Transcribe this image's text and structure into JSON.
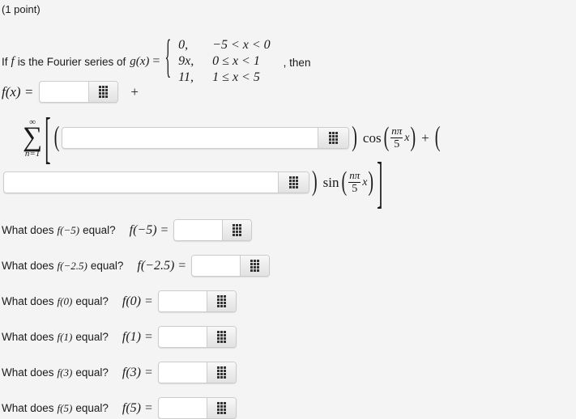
{
  "header": {
    "point_label": "(1 point)"
  },
  "problem": {
    "intro_prefix": "If",
    "intro_f": "f",
    "intro_middle": "is the Fourier series of",
    "intro_g": "g(x)",
    "equals": "=",
    "then_text": ", then",
    "cases": [
      {
        "value": "0,",
        "condition": "−5 < x < 0"
      },
      {
        "value": "9x,",
        "condition": "0 ≤ x < 1"
      },
      {
        "value": "11,",
        "condition": "1 ≤ x < 5"
      }
    ]
  },
  "series": {
    "fx_label": "f(x) =",
    "plus_label": "+",
    "sigma_top": "∞",
    "sigma_symbol": "∑",
    "sigma_bottom": "n=1",
    "bracket_open": "[",
    "bracket_close": "]",
    "paren_open": "(",
    "paren_close": ")",
    "cos_label": "cos",
    "sin_label": "sin",
    "frac_numerator": "nπ",
    "frac_denominator": "5",
    "frac_variable": "x",
    "inner_plus": "+"
  },
  "inputs": {
    "placeholder": "",
    "fx_value": "",
    "cos_coeff_value": "",
    "sin_coeff_value": "",
    "grid_icon_name": "grid-icon"
  },
  "questions": [
    {
      "prompt_prefix": "What does",
      "prompt_fn": "f(−5)",
      "prompt_suffix": "equal?",
      "eq_label": "f(−5) =",
      "value": ""
    },
    {
      "prompt_prefix": "What does",
      "prompt_fn": "f(−2.5)",
      "prompt_suffix": "equal?",
      "eq_label": "f(−2.5) =",
      "value": ""
    },
    {
      "prompt_prefix": "What does",
      "prompt_fn": "f(0)",
      "prompt_suffix": "equal?",
      "eq_label": "f(0) =",
      "value": ""
    },
    {
      "prompt_prefix": "What does",
      "prompt_fn": "f(1)",
      "prompt_suffix": "equal?",
      "eq_label": "f(1) =",
      "value": ""
    },
    {
      "prompt_prefix": "What does",
      "prompt_fn": "f(3)",
      "prompt_suffix": "equal?",
      "eq_label": "f(3) =",
      "value": ""
    },
    {
      "prompt_prefix": "What does",
      "prompt_fn": "f(5)",
      "prompt_suffix": "equal?",
      "eq_label": "f(5) =",
      "value": ""
    }
  ],
  "colors": {
    "background": "#f4f4f4",
    "text": "#1a1a1a",
    "field_background": "#ffffff",
    "field_border": "#cccccc",
    "button_face": "#ececec",
    "icon_dot": "#333333"
  }
}
